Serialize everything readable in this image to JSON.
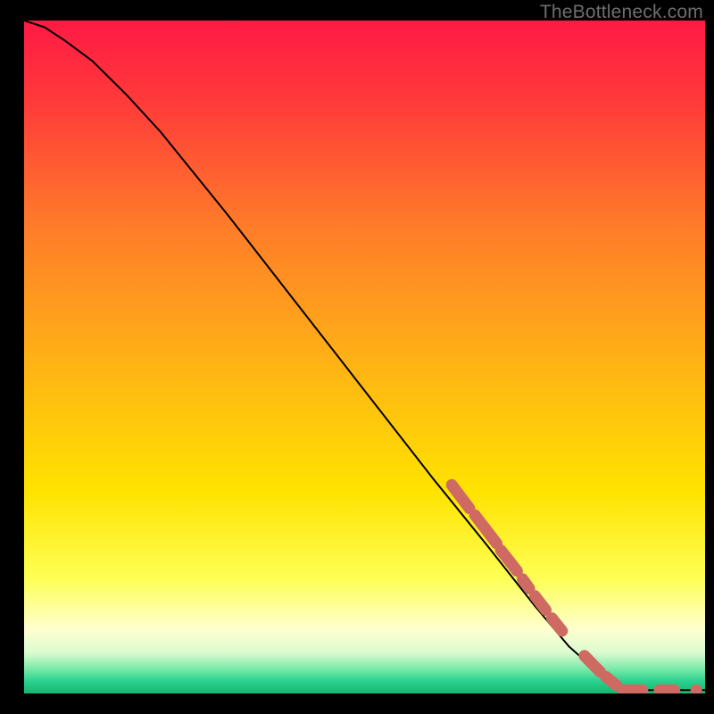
{
  "watermark": "TheBottleneck.com",
  "chart_data": {
    "type": "line",
    "title": "",
    "xlabel": "",
    "ylabel": "",
    "xlim": [
      0,
      100
    ],
    "ylim": [
      0,
      100
    ],
    "grid": false,
    "series": [
      {
        "name": "curve",
        "color": "#000000",
        "x": [
          0,
          3,
          6,
          10,
          15,
          20,
          30,
          40,
          50,
          60,
          68,
          75,
          80,
          85,
          88.5,
          90,
          95,
          100
        ],
        "y": [
          100,
          99,
          97,
          94,
          89,
          83.5,
          71,
          58,
          45,
          32,
          22,
          13,
          7,
          2.5,
          0.5,
          0.5,
          0.5,
          0.5
        ]
      }
    ],
    "markers": [
      {
        "name": "dash-segment",
        "shape": "pill",
        "color": "#cf6a62",
        "x0": 62.8,
        "y0": 31.0,
        "x1": 65.4,
        "y1": 27.5,
        "w": 13
      },
      {
        "name": "dash-segment",
        "shape": "pill",
        "color": "#cf6a62",
        "x0": 66.2,
        "y0": 26.5,
        "x1": 69.4,
        "y1": 22.3,
        "w": 13
      },
      {
        "name": "dash-segment",
        "shape": "pill",
        "color": "#cf6a62",
        "x0": 70.0,
        "y0": 21.3,
        "x1": 72.4,
        "y1": 18.2,
        "w": 13
      },
      {
        "name": "dash-segment",
        "shape": "pill",
        "color": "#cf6a62",
        "x0": 73.2,
        "y0": 17.0,
        "x1": 74.2,
        "y1": 15.6,
        "w": 13
      },
      {
        "name": "dash-segment",
        "shape": "pill",
        "color": "#cf6a62",
        "x0": 75.0,
        "y0": 14.5,
        "x1": 76.6,
        "y1": 12.4,
        "w": 13
      },
      {
        "name": "dash-segment",
        "shape": "pill",
        "color": "#cf6a62",
        "x0": 77.5,
        "y0": 11.2,
        "x1": 79.0,
        "y1": 9.3,
        "w": 13
      },
      {
        "name": "dash-segment",
        "shape": "pill",
        "color": "#cf6a62",
        "x0": 82.3,
        "y0": 5.6,
        "x1": 84.6,
        "y1": 3.2,
        "w": 13
      },
      {
        "name": "dash-segment",
        "shape": "pill",
        "color": "#cf6a62",
        "x0": 85.4,
        "y0": 2.5,
        "x1": 87.0,
        "y1": 1.2,
        "w": 13
      },
      {
        "name": "dash-segment",
        "shape": "pill",
        "color": "#cf6a62",
        "x0": 88.0,
        "y0": 0.5,
        "x1": 90.8,
        "y1": 0.5,
        "w": 13
      },
      {
        "name": "dash-segment",
        "shape": "pill",
        "color": "#cf6a62",
        "x0": 93.3,
        "y0": 0.5,
        "x1": 95.5,
        "y1": 0.5,
        "w": 13
      },
      {
        "name": "dash-dot",
        "shape": "dot",
        "color": "#cf6a62",
        "cx": 98.7,
        "cy": 0.5,
        "r": 6.5
      }
    ],
    "gradient_stops": [
      {
        "offset": 0.0,
        "color": "#ff1a44"
      },
      {
        "offset": 0.12,
        "color": "#ff3a3a"
      },
      {
        "offset": 0.3,
        "color": "#ff7a2a"
      },
      {
        "offset": 0.5,
        "color": "#ffb016"
      },
      {
        "offset": 0.7,
        "color": "#ffe300"
      },
      {
        "offset": 0.83,
        "color": "#feff55"
      },
      {
        "offset": 0.905,
        "color": "#ffffd0"
      },
      {
        "offset": 0.94,
        "color": "#d9fbcf"
      },
      {
        "offset": 0.965,
        "color": "#74e8a6"
      },
      {
        "offset": 0.982,
        "color": "#2ad08e"
      },
      {
        "offset": 1.0,
        "color": "#18b56f"
      }
    ]
  }
}
